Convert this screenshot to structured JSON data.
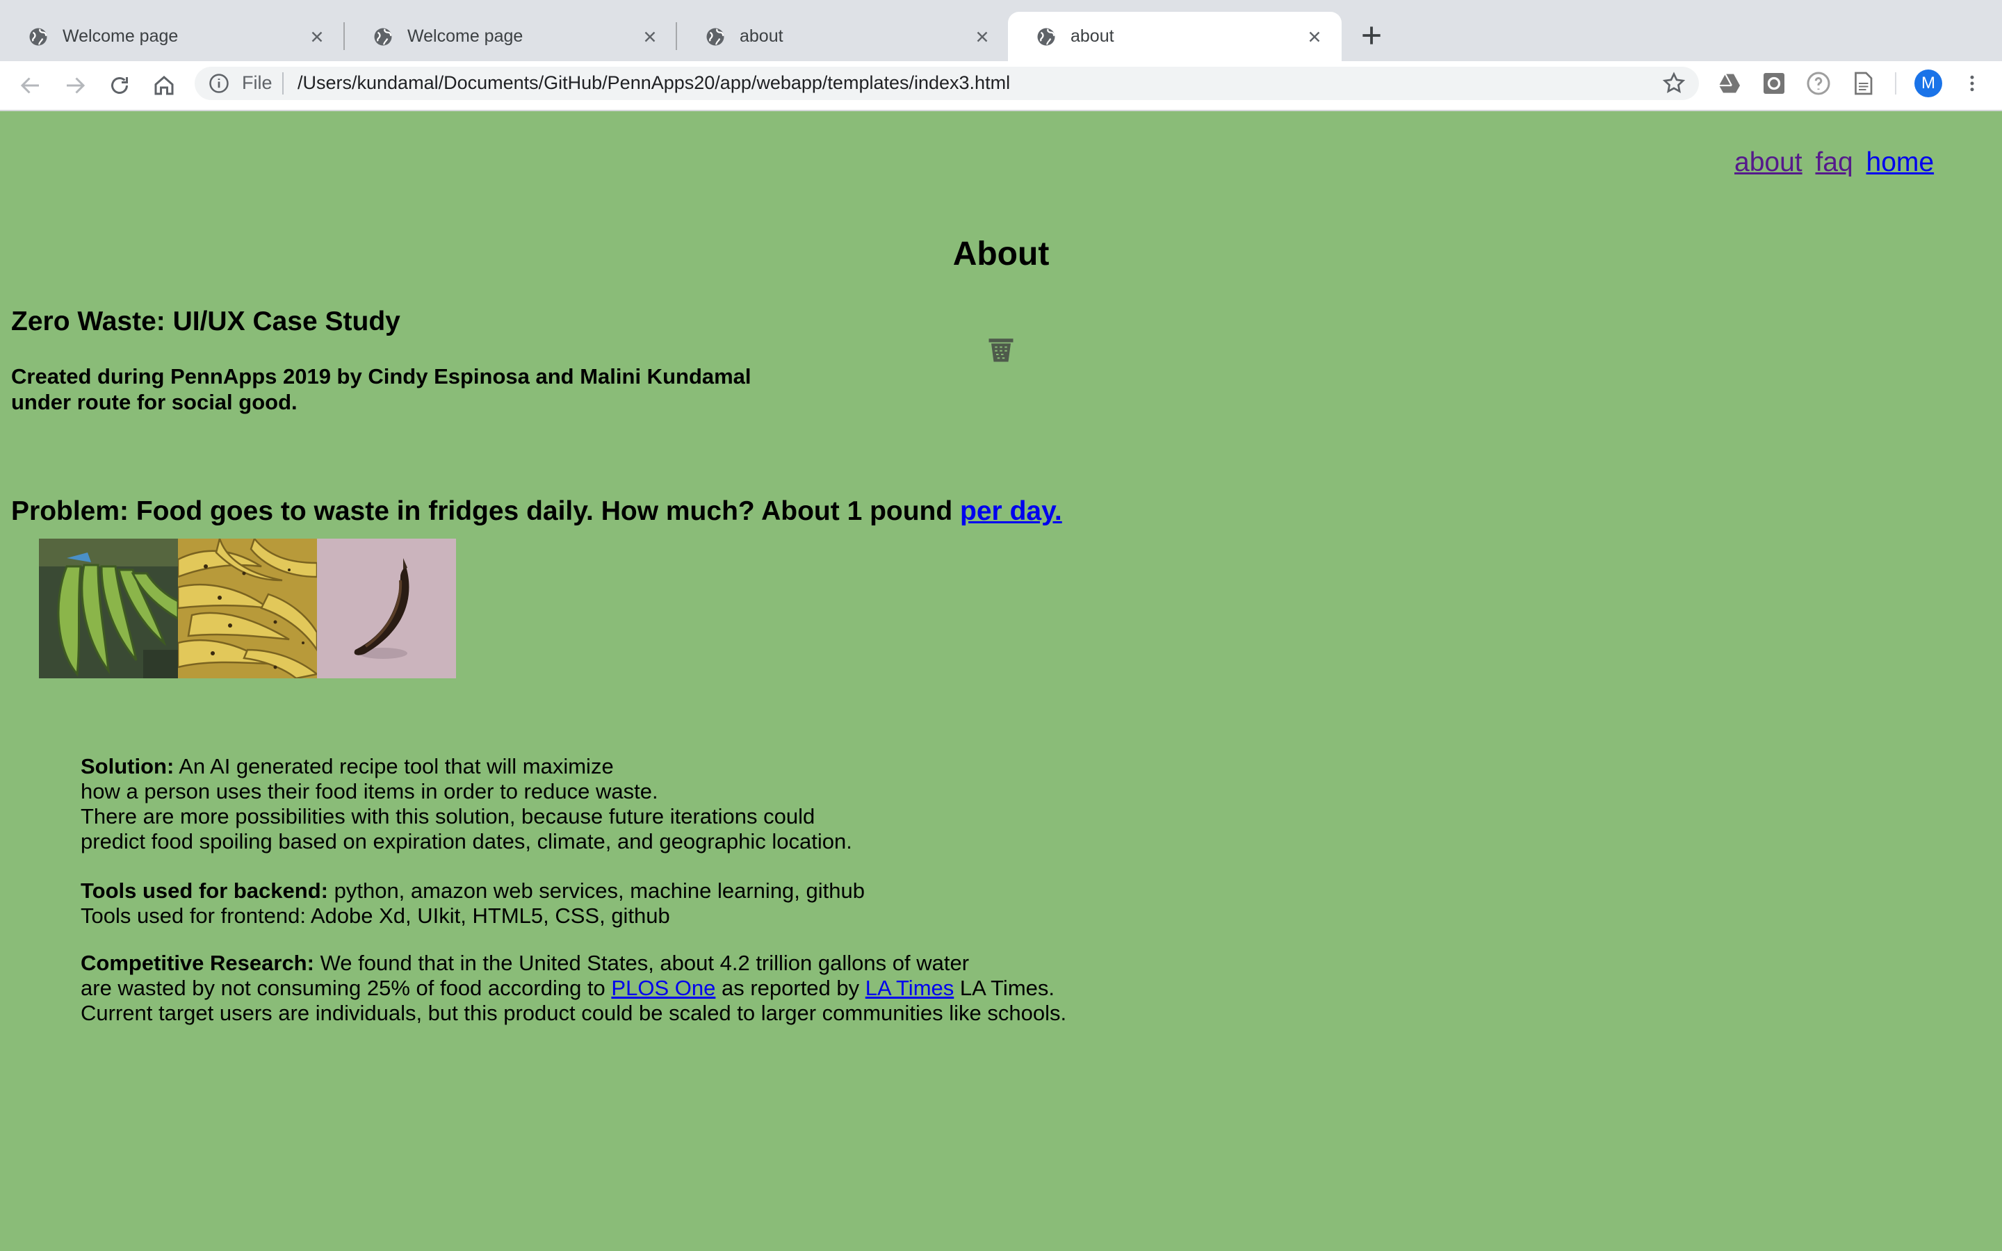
{
  "browser": {
    "tabs": [
      {
        "title": "Welcome page",
        "active": false
      },
      {
        "title": "Welcome page",
        "active": false
      },
      {
        "title": "about",
        "active": false
      },
      {
        "title": "about",
        "active": true
      }
    ],
    "omnibox": {
      "scheme_label": "File",
      "url": "/Users/kundamal/Documents/GitHub/PennApps20/app/webapp/templates/index3.html"
    },
    "profile_initial": "M"
  },
  "page": {
    "nav": {
      "about": "about",
      "faq": "faq",
      "home": "home"
    },
    "title": "About",
    "subtitle": "Zero Waste: UI/UX Case Study",
    "credits_line1": "Created during PennApps 2019 by Cindy Espinosa and Malini Kundamal",
    "credits_line2": "under route for social good.",
    "problem_text": "Problem: Food goes to waste in fridges daily. How much? About 1 pound",
    "problem_link": "per day.",
    "images": [
      "green bananas",
      "ripe yellow bananas",
      "overripe brown banana"
    ],
    "solution_label": "Solution:",
    "solution_line1": "An AI generated recipe tool that will maximize",
    "solution_line2": "how a person uses their food items in order to reduce waste.",
    "solution_line3": "There are more possibilities with this solution, because future iterations could",
    "solution_line4": "predict food spoiling based on expiration dates, climate, and geographic location.",
    "backend_label": "Tools used for backend:",
    "backend_text": "python, amazon web services, machine learning, github",
    "frontend_text": "Tools used for frontend: Adobe Xd, UIkit, HTML5, CSS, github",
    "research_label": "Competitive Research:",
    "research_line1": "We found that in the United States, about 4.2 trillion gallons of water",
    "research_line2_a": "are wasted by not consuming 25% of food according to",
    "research_link1": "PLOS One",
    "research_line2_b": "as reported by",
    "research_link2": "LA Times",
    "research_line2_c": "LA Times.",
    "research_line3": "Current target users are individuals, but this product could be scaled to larger communities like schools."
  },
  "colors": {
    "page_background": "#8abc78",
    "link": "#0000ee",
    "visited_link": "#551a8b",
    "tabstrip": "#dee1e6",
    "avatar": "#1a73e8"
  }
}
